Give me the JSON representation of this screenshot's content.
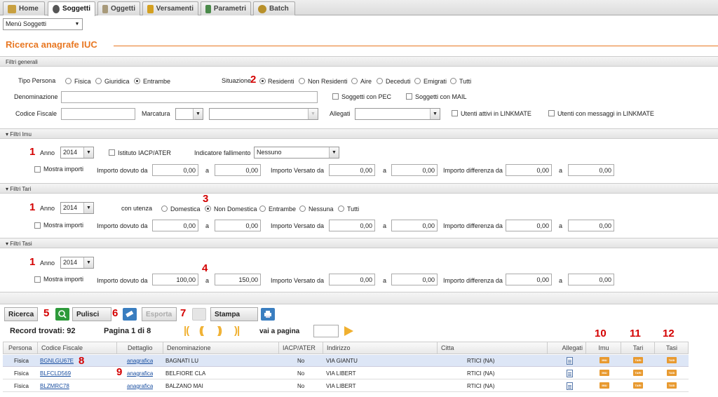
{
  "tabs": [
    {
      "label": "Home",
      "icon": "home-icon"
    },
    {
      "label": "Soggetti",
      "icon": "user-icon"
    },
    {
      "label": "Oggetti",
      "icon": "building-icon"
    },
    {
      "label": "Versamenti",
      "icon": "payment-icon"
    },
    {
      "label": "Parametri",
      "icon": "table-icon"
    },
    {
      "label": "Batch",
      "icon": "gear-icon"
    }
  ],
  "menu": {
    "selected": "Menù Soggetti"
  },
  "page_title": "Ricerca anagrafe IUC",
  "filtri_generali": {
    "title": "Filtri generali",
    "tipo_persona_label": "Tipo Persona",
    "tipo_persona_options": [
      "Fisica",
      "Giuridica",
      "Entrambe"
    ],
    "situazione_label": "Situazione",
    "situazione_options": [
      "Residenti",
      "Non Residenti",
      "Aire",
      "Deceduti",
      "Emigrati",
      "Tutti"
    ],
    "denominazione_label": "Denominazione",
    "soggetti_pec": "Soggetti con PEC",
    "soggetti_mail": "Soggetti con MAIL",
    "codice_fiscale_label": "Codice Fiscale",
    "marcatura_label": "Marcatura",
    "allegati_label": "Allegati",
    "utenti_attivi": "Utenti attivi in LINKMATE",
    "utenti_messaggi": "Utenti con messaggi in LINKMATE"
  },
  "filtri_imu": {
    "title": "Filtri Imu",
    "anno_label": "Anno",
    "anno": "2014",
    "istituto": "Istituto IACP/ATER",
    "fallimento_label": "Indicatore fallimento",
    "fallimento": "Nessuno",
    "mostra_importi": "Mostra importi",
    "dovuto_label": "Importo dovuto da",
    "a_label": "a",
    "versato_label": "Importo Versato da",
    "differenza_label": "Importo differenza da",
    "values": [
      "0,00",
      "0,00",
      "0,00",
      "0,00",
      "0,00",
      "0,00"
    ]
  },
  "filtri_tari": {
    "title": "Filtri Tari",
    "anno_label": "Anno",
    "anno": "2014",
    "utenza_label": "con utenza",
    "utenza_options": [
      "Domestica",
      "Non Domestica",
      "Entrambe",
      "Nessuna",
      "Tutti"
    ],
    "mostra_importi": "Mostra importi",
    "dovuto_label": "Importo dovuto da",
    "a_label": "a",
    "versato_label": "Importo Versato da",
    "differenza_label": "Importo differenza da",
    "values": [
      "0,00",
      "0,00",
      "0,00",
      "0,00",
      "0,00",
      "0,00"
    ]
  },
  "filtri_tasi": {
    "title": "Filtri Tasi",
    "anno_label": "Anno",
    "anno": "2014",
    "mostra_importi": "Mostra importi",
    "dovuto_label": "Importo dovuto da",
    "a_label": "a",
    "versato_label": "Importo Versato da",
    "differenza_label": "Importo differenza da",
    "values": [
      "100,00",
      "150,00",
      "0,00",
      "0,00",
      "0,00",
      "0,00"
    ]
  },
  "buttons": {
    "ricerca": "Ricerca",
    "pulisci": "Pulisci",
    "esporta": "Esporta",
    "stampa": "Stampa"
  },
  "pager": {
    "records": "Record trovati: 92",
    "page": "Pagina 1 di 8",
    "goto": "vai a pagina"
  },
  "annotations": [
    "1",
    "2",
    "3",
    "4",
    "5",
    "6",
    "7",
    "8",
    "9",
    "10",
    "11",
    "12"
  ],
  "table": {
    "columns": [
      "Persona",
      "Codice Fiscale",
      "Dettaglio",
      "Denominazione",
      "IACP/ATER",
      "Indirizzo",
      "Citta",
      "Allegati",
      "Imu",
      "Tari",
      "Tasi"
    ],
    "rows": [
      {
        "persona": "Fisica",
        "cf": "BGNLGU67E",
        "dettaglio": "anagrafica",
        "denominazione": "BAGNATI LU",
        "iacp": "No",
        "indirizzo": "VIA GIANTU",
        "citta": "RTICI (NA)"
      },
      {
        "persona": "Fisica",
        "cf": "BLFCLD569",
        "dettaglio": "anagrafica",
        "denominazione": "BELFIORE CLA",
        "iacp": "No",
        "indirizzo": "VIA LIBERT",
        "citta": "RTICI (NA)"
      },
      {
        "persona": "Fisica",
        "cf": "BLZMRC78",
        "dettaglio": "anagrafica",
        "denominazione": "BALZANO MAI",
        "iacp": "No",
        "indirizzo": "VIA LIBERT",
        "citta": "RTICI (NA)"
      }
    ],
    "tag_labels": {
      "imu": "IMU",
      "tari": "TARI",
      "tasi": "TASI"
    }
  },
  "colors": {
    "accent": "#e87722",
    "annotation": "#d40000",
    "link": "#1a4fa0"
  }
}
